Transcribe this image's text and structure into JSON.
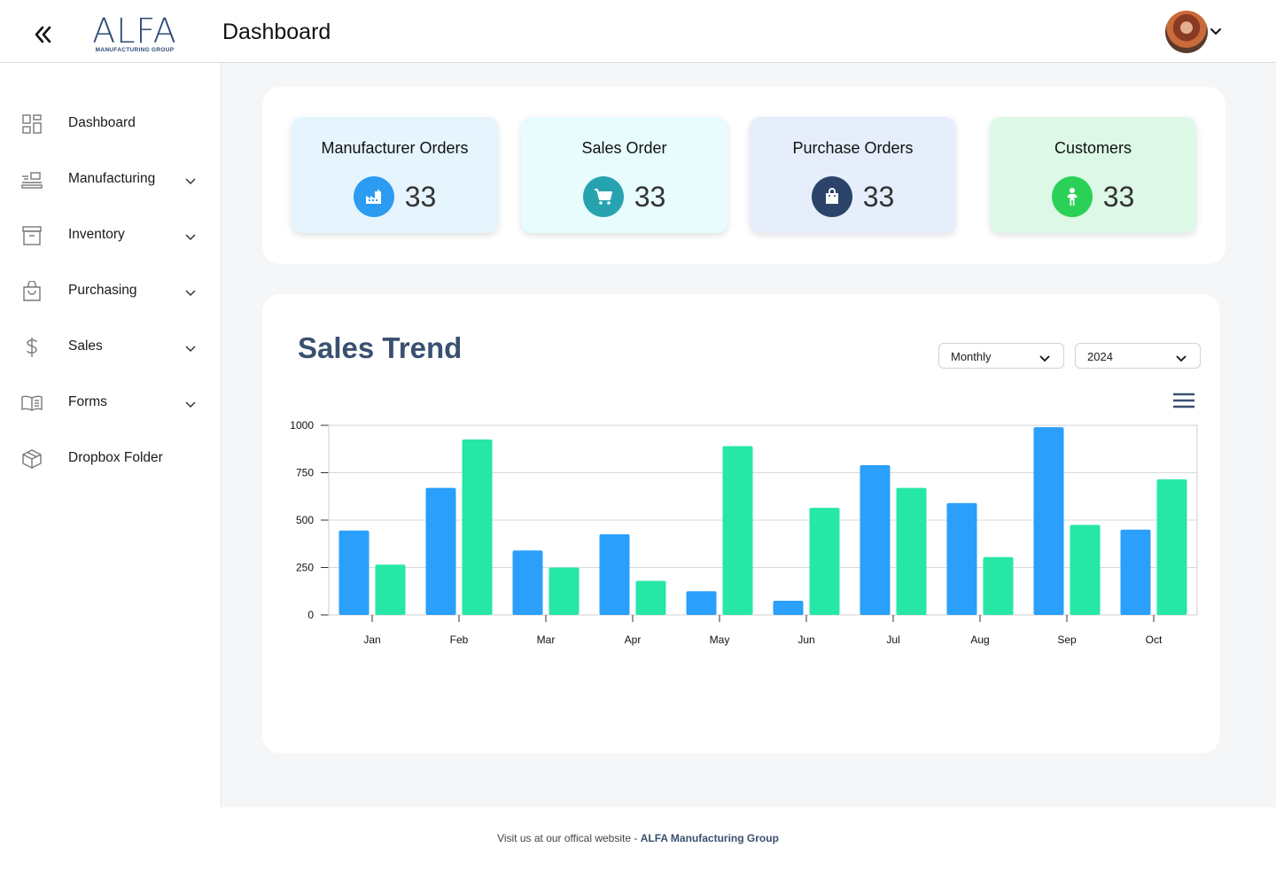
{
  "header": {
    "title": "Dashboard",
    "logo_text": "ALFA",
    "logo_subtext": "MANUFACTURING GROUP",
    "collapse_icon": "double-chevron-left-icon",
    "user_menu_icon": "chevron-down-icon"
  },
  "sidebar": {
    "items": [
      {
        "label": "Dashboard",
        "icon": "grid-icon",
        "has_submenu": false
      },
      {
        "label": "Manufacturing",
        "icon": "conveyor-icon",
        "has_submenu": true
      },
      {
        "label": "Inventory",
        "icon": "archive-box-icon",
        "has_submenu": true
      },
      {
        "label": "Purchasing",
        "icon": "shopping-bag-icon",
        "has_submenu": true
      },
      {
        "label": "Sales",
        "icon": "dollar-icon",
        "has_submenu": true
      },
      {
        "label": "Forms",
        "icon": "book-icon",
        "has_submenu": true
      },
      {
        "label": "Dropbox Folder",
        "icon": "package-icon",
        "has_submenu": false
      }
    ]
  },
  "stats": [
    {
      "title": "Manufacturer Orders",
      "value": "33",
      "icon": "factory-icon",
      "bg": "#e6f4fd",
      "icon_bg": "#2b9cf2"
    },
    {
      "title": "Sales Order",
      "value": "33",
      "icon": "cart-icon",
      "bg": "#e8fbfd",
      "icon_bg": "#27a3b0"
    },
    {
      "title": "Purchase Orders",
      "value": "33",
      "icon": "bag-icon",
      "bg": "#e5eefa",
      "icon_bg": "#2c4469"
    },
    {
      "title": "Customers",
      "value": "33",
      "icon": "person-icon",
      "bg": "#ddf8e6",
      "icon_bg": "#2bd157"
    }
  ],
  "sales_trend": {
    "title": "Sales Trend",
    "period_select": "Monthly",
    "year_select": "2024",
    "menu_icon": "hamburger-menu-icon"
  },
  "chart_data": {
    "type": "bar",
    "categories": [
      "Jan",
      "Feb",
      "Mar",
      "Apr",
      "May",
      "Jun",
      "Jul",
      "Aug",
      "Sep",
      "Oct"
    ],
    "series": [
      {
        "values": [
          445,
          670,
          340,
          425,
          125,
          75,
          790,
          590,
          990,
          450
        ],
        "color": "#2a9ffc"
      },
      {
        "values": [
          265,
          925,
          250,
          180,
          890,
          565,
          670,
          305,
          475,
          715
        ],
        "color": "#26e7a6"
      }
    ],
    "yticks": [
      0,
      250,
      500,
      750,
      1000
    ],
    "ylim": [
      0,
      1000
    ],
    "grid": true,
    "legend": "none"
  },
  "footer": {
    "text": "Visit us at our offical website - ",
    "link": "ALFA Manufacturing Group"
  }
}
